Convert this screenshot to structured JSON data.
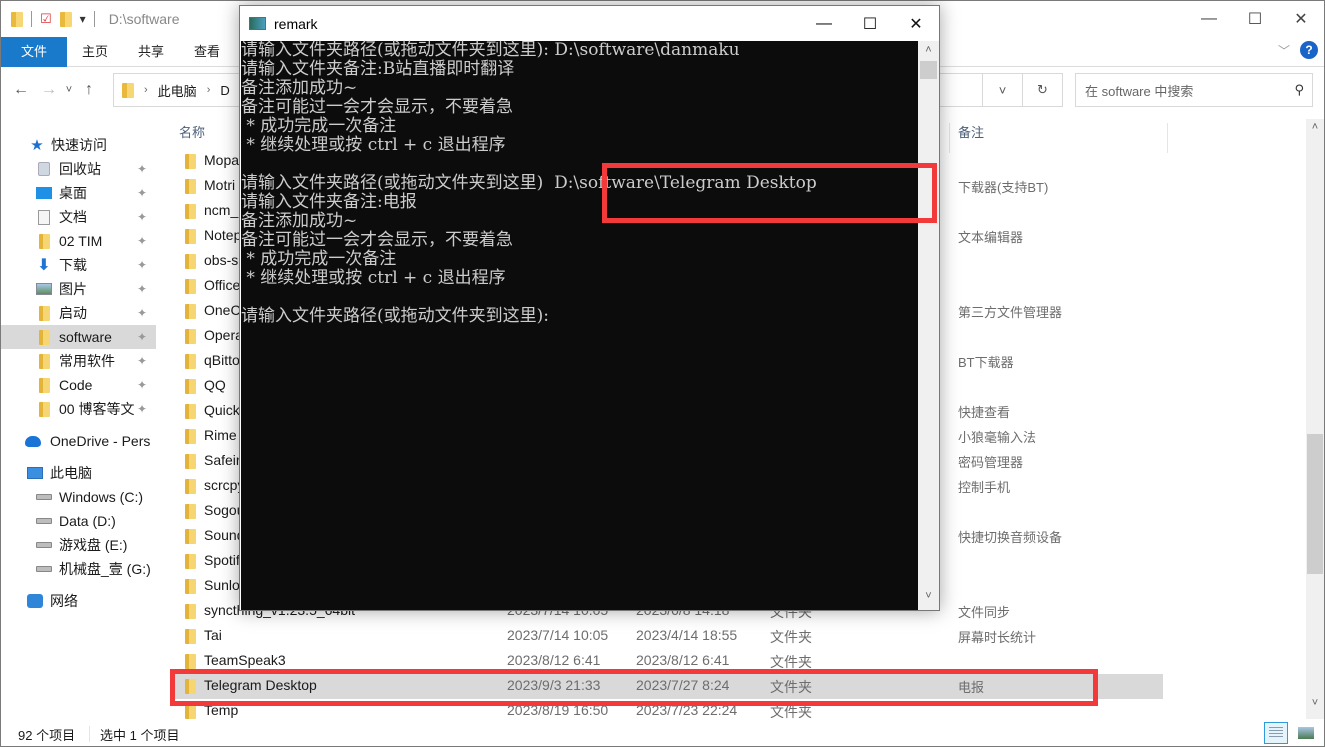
{
  "explorer": {
    "title_path": "D:\\software",
    "window_controls": {
      "minimize": "—",
      "maximize": "☐",
      "close": "✕"
    },
    "ribbon": {
      "tabs": [
        "文件",
        "主页",
        "共享",
        "查看"
      ],
      "expand_icon": "﹀",
      "help_icon": "?"
    },
    "nav": {
      "back": "←",
      "forward": "→",
      "recent": "˅",
      "up": "↑",
      "address": [
        "此电脑",
        "D"
      ],
      "address_dropdown": "˅",
      "refresh": "↻",
      "search_placeholder": "在 software 中搜索",
      "search_icon": "⚲"
    },
    "sidebar": {
      "items": [
        {
          "label": "快速访问",
          "icon": "star-icon",
          "pinned": false
        },
        {
          "label": "回收站",
          "icon": "recycle-bin-icon",
          "pinned": true
        },
        {
          "label": "桌面",
          "icon": "desktop-icon",
          "pinned": true
        },
        {
          "label": "文档",
          "icon": "document-icon",
          "pinned": true
        },
        {
          "label": "02 TIM",
          "icon": "folder-icon",
          "pinned": true
        },
        {
          "label": "下载",
          "icon": "download-icon",
          "pinned": true
        },
        {
          "label": "图片",
          "icon": "pictures-icon",
          "pinned": true
        },
        {
          "label": "启动",
          "icon": "folder-icon",
          "pinned": true
        },
        {
          "label": "software",
          "icon": "folder-icon",
          "pinned": true,
          "selected": true
        },
        {
          "label": "常用软件",
          "icon": "folder-icon",
          "pinned": true
        },
        {
          "label": "Code",
          "icon": "folder-icon",
          "pinned": true
        },
        {
          "label": "00 博客等文",
          "icon": "folder-icon",
          "pinned": true
        },
        {
          "label": "OneDrive - Pers",
          "icon": "onedrive-icon",
          "pinned": false
        },
        {
          "label": "此电脑",
          "icon": "this-pc-icon",
          "pinned": false
        },
        {
          "label": "Windows (C:)",
          "icon": "drive-icon",
          "pinned": false
        },
        {
          "label": "Data (D:)",
          "icon": "drive-icon",
          "pinned": false
        },
        {
          "label": "游戏盘 (E:)",
          "icon": "drive-icon",
          "pinned": false
        },
        {
          "label": "机械盘_壹 (G:)",
          "icon": "drive-icon",
          "pinned": false
        },
        {
          "label": "网络",
          "icon": "network-icon",
          "pinned": false
        }
      ],
      "pin_icon": "📌"
    },
    "columns": {
      "name": "名称",
      "remark": "备注"
    },
    "files": [
      {
        "name": "Mopa",
        "date_accessed": "",
        "date_modified": "",
        "type": "",
        "remark": ""
      },
      {
        "name": "Motri",
        "date_accessed": "",
        "date_modified": "",
        "type": "",
        "remark": "下载器(支持BT)"
      },
      {
        "name": "ncm_",
        "date_accessed": "",
        "date_modified": "",
        "type": "",
        "remark": ""
      },
      {
        "name": "Notep",
        "date_accessed": "",
        "date_modified": "",
        "type": "",
        "remark": "文本编辑器"
      },
      {
        "name": "obs-s",
        "date_accessed": "",
        "date_modified": "",
        "type": "",
        "remark": ""
      },
      {
        "name": "Office",
        "date_accessed": "",
        "date_modified": "",
        "type": "",
        "remark": ""
      },
      {
        "name": "OneC",
        "date_accessed": "",
        "date_modified": "",
        "type": "",
        "remark": "第三方文件管理器"
      },
      {
        "name": "Opera",
        "date_accessed": "",
        "date_modified": "",
        "type": "",
        "remark": ""
      },
      {
        "name": "qBitto",
        "date_accessed": "",
        "date_modified": "",
        "type": "",
        "remark": "BT下载器"
      },
      {
        "name": "QQ",
        "date_accessed": "",
        "date_modified": "",
        "type": "",
        "remark": ""
      },
      {
        "name": "Quick",
        "date_accessed": "",
        "date_modified": "",
        "type": "",
        "remark": "快捷查看"
      },
      {
        "name": "Rime",
        "date_accessed": "",
        "date_modified": "",
        "type": "",
        "remark": "小狼毫输入法"
      },
      {
        "name": "Safeir",
        "date_accessed": "",
        "date_modified": "",
        "type": "",
        "remark": "密码管理器"
      },
      {
        "name": "scrcpy",
        "date_accessed": "",
        "date_modified": "",
        "type": "",
        "remark": "控制手机"
      },
      {
        "name": "Sogou",
        "date_accessed": "",
        "date_modified": "",
        "type": "",
        "remark": ""
      },
      {
        "name": "Sound",
        "date_accessed": "",
        "date_modified": "",
        "type": "",
        "remark": "快捷切换音频设备"
      },
      {
        "name": "Spotif",
        "date_accessed": "",
        "date_modified": "",
        "type": "",
        "remark": ""
      },
      {
        "name": "Sunlo",
        "date_accessed": "",
        "date_modified": "",
        "type": "",
        "remark": ""
      },
      {
        "name": "syncthing_v1.23.5_64bit",
        "date_accessed": "2023/7/14 10:05",
        "date_modified": "2023/6/8 14:18",
        "type": "文件夹",
        "remark": "文件同步"
      },
      {
        "name": "Tai",
        "date_accessed": "2023/7/14 10:05",
        "date_modified": "2023/4/14 18:55",
        "type": "文件夹",
        "remark": "屏幕时长统计"
      },
      {
        "name": "TeamSpeak3",
        "date_accessed": "2023/8/12 6:41",
        "date_modified": "2023/8/12 6:41",
        "type": "文件夹",
        "remark": ""
      },
      {
        "name": "Telegram Desktop",
        "date_accessed": "2023/9/3 21:33",
        "date_modified": "2023/7/27 8:24",
        "type": "文件夹",
        "remark": "电报",
        "selected": true
      },
      {
        "name": "Temp",
        "date_accessed": "2023/8/19 16:50",
        "date_modified": "2023/7/23 22:24",
        "type": "文件夹",
        "remark": ""
      }
    ],
    "status": {
      "count": "92 个项目",
      "selected": "选中 1 个项目"
    },
    "scroll": {
      "up": "˄",
      "down": "˅"
    }
  },
  "console": {
    "title": "remark",
    "window_controls": {
      "minimize": "—",
      "maximize": "☐",
      "close": "✕"
    },
    "lines": [
      "请输入文件夹路径(或拖动文件夹到这里): D:\\software\\danmaku",
      "请输入文件夹备注:B站直播即时翻译",
      "备注添加成功~",
      "备注可能过一会才会显示，不要着急",
      " * 成功完成一次备注",
      " * 继续处理或按 ctrl + c 退出程序",
      "",
      "请输入文件夹路径(或拖动文件夹到这里)  D:\\software\\Telegram Desktop",
      "请输入文件夹备注:电报",
      "备注添加成功~",
      "备注可能过一会才会显示，不要着急",
      " * 成功完成一次备注",
      " * 继续处理或按 ctrl + c 退出程序",
      "",
      "请输入文件夹路径(或拖动文件夹到这里):"
    ],
    "scroll": {
      "up": "˄",
      "down": "˅"
    }
  },
  "annotations": {
    "color": "#f23a3a"
  }
}
